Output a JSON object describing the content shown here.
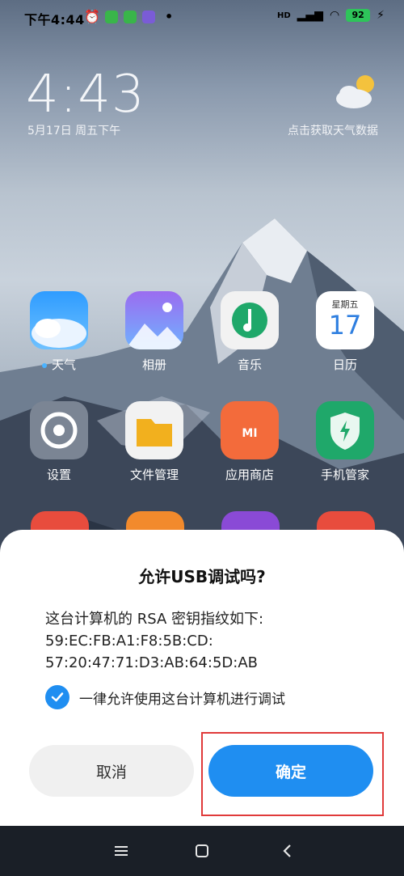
{
  "status_bar": {
    "time": "下午4:44",
    "network": "HD",
    "battery_level": "92",
    "colors": {
      "battery": "#2ec45a"
    }
  },
  "lockscreen": {
    "clock": "4:43",
    "date": "5月17日 周五下午",
    "weather_text": "点击获取天气数据"
  },
  "apps": [
    {
      "label": "天气",
      "icon": "weather-app-icon",
      "has_dot": true
    },
    {
      "label": "相册",
      "icon": "gallery-app-icon"
    },
    {
      "label": "音乐",
      "icon": "music-app-icon"
    },
    {
      "label": "日历",
      "icon": "calendar-app-icon",
      "weekday": "星期五",
      "day": "17"
    },
    {
      "label": "设置",
      "icon": "settings-app-icon"
    },
    {
      "label": "文件管理",
      "icon": "file-manager-app-icon"
    },
    {
      "label": "应用商店",
      "icon": "app-store-app-icon",
      "badge_text": "MI"
    },
    {
      "label": "手机管家",
      "icon": "security-app-icon"
    }
  ],
  "dialog": {
    "title": "允许USB调试吗?",
    "body_line1": "这台计算机的 RSA 密钥指纹如下:",
    "body_line2": "59:EC:FB:A1:F8:5B:CD:",
    "body_line3": "57:20:47:71:D3:AB:64:5D:AB",
    "checkbox_label": "一律允许使用这台计算机进行调试",
    "checkbox_checked": true,
    "cancel_label": "取消",
    "ok_label": "确定",
    "colors": {
      "accent": "#1f8ef1",
      "highlight": "#e03a3a"
    }
  },
  "nav_bar": {
    "menu_icon": "menu-icon",
    "home_icon": "home-icon",
    "back_icon": "back-icon"
  }
}
